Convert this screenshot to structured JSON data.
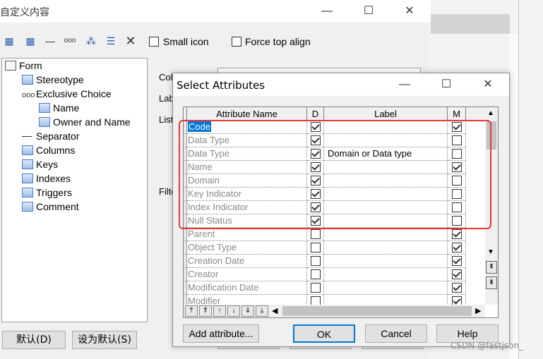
{
  "back_window": {
    "title": "自定义内容",
    "toolbar": {
      "small_icon_label": "Small icon",
      "force_top_align_label": "Force top align"
    },
    "tree": [
      {
        "label": "Form",
        "indent": 0,
        "icon": "form-icon"
      },
      {
        "label": "Stereotype",
        "indent": 1,
        "icon": "item-icon"
      },
      {
        "label": "Exclusive Choice",
        "indent": 1,
        "icon": "choice-icon"
      },
      {
        "label": "Name",
        "indent": 2,
        "icon": "item-icon"
      },
      {
        "label": "Owner and Name",
        "indent": 2,
        "icon": "item-icon"
      },
      {
        "label": "Separator",
        "indent": 1,
        "icon": "separator-icon"
      },
      {
        "label": "Columns",
        "indent": 1,
        "icon": "item-icon"
      },
      {
        "label": "Keys",
        "indent": 1,
        "icon": "item-icon"
      },
      {
        "label": "Indexes",
        "indent": 1,
        "icon": "item-icon"
      },
      {
        "label": "Triggers",
        "indent": 1,
        "icon": "item-icon"
      },
      {
        "label": "Comment",
        "indent": 1,
        "icon": "item-icon"
      }
    ],
    "panel_labels": [
      "Coll",
      "Lab",
      "List",
      "Filte"
    ],
    "buttons": {
      "default_label": "默认(D)",
      "set_default_label": "设为默认(S)"
    }
  },
  "dialog": {
    "title": "Select Attributes",
    "columns": {
      "name": "Attribute Name",
      "d": "D",
      "label": "Label",
      "m": "M"
    },
    "rows": [
      {
        "name": "Code",
        "d": true,
        "label": "",
        "m": true,
        "selected": true
      },
      {
        "name": "Data Type",
        "d": true,
        "label": "",
        "m": false
      },
      {
        "name": "Data Type",
        "d": true,
        "label": "Domain or Data type",
        "m": false
      },
      {
        "name": "Name",
        "d": true,
        "label": "",
        "m": true
      },
      {
        "name": "Domain",
        "d": true,
        "label": "",
        "m": false
      },
      {
        "name": "Key Indicator",
        "d": true,
        "label": "",
        "m": false
      },
      {
        "name": "Index Indicator",
        "d": true,
        "label": "",
        "m": false
      },
      {
        "name": "Null Status",
        "d": true,
        "label": "",
        "m": false
      },
      {
        "name": "Parent",
        "d": false,
        "label": "",
        "m": true
      },
      {
        "name": "Object Type",
        "d": false,
        "label": "",
        "m": true
      },
      {
        "name": "Creation Date",
        "d": false,
        "label": "",
        "m": true
      },
      {
        "name": "Creator",
        "d": false,
        "label": "",
        "m": true
      },
      {
        "name": "Modification Date",
        "d": false,
        "label": "",
        "m": true
      },
      {
        "name": "Modifier",
        "d": false,
        "label": "",
        "m": true
      }
    ],
    "buttons": {
      "add_attribute": "Add attribute...",
      "ok": "OK",
      "cancel": "Cancel",
      "help": "Help"
    }
  },
  "watermark": "CSDN @fastjson_",
  "highlight_color": "#e53935",
  "selection_color": "#0078d7"
}
